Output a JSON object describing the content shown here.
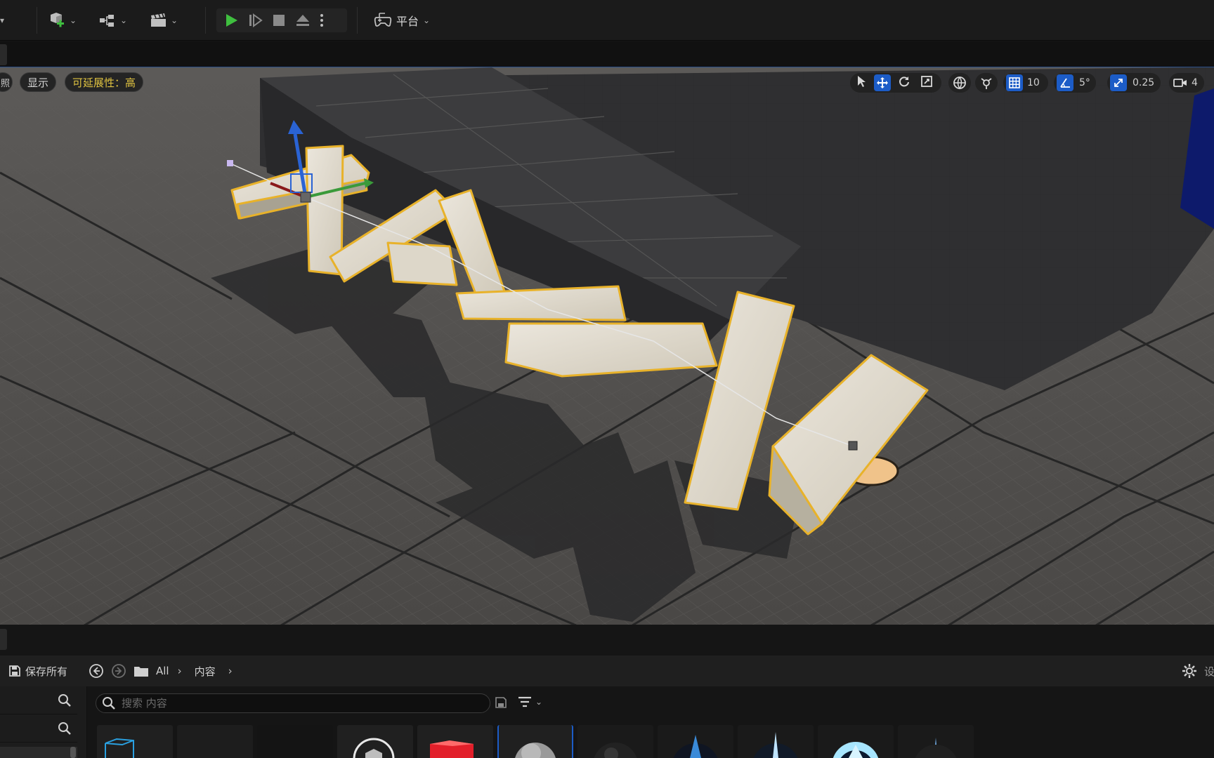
{
  "toolbar": {
    "play_options_icon": "more-vertical-icon",
    "platforms_label": "平台"
  },
  "viewport": {
    "show_label": "显示",
    "scalability_label": "可延展性：高",
    "grid_snap_value": "10",
    "rotation_snap_value": "5°",
    "scale_snap_value": "0.25",
    "camera_speed_value": "4"
  },
  "content_browser": {
    "save_all_label": "保存所有",
    "path": [
      "All",
      "内容"
    ],
    "search_placeholder": "搜索 内容"
  },
  "colors": {
    "accent_blue": "#1c5cc7",
    "play_green": "#3fbf3f",
    "selection_outline": "#e8b22a",
    "scalability_text": "#e0c341"
  }
}
